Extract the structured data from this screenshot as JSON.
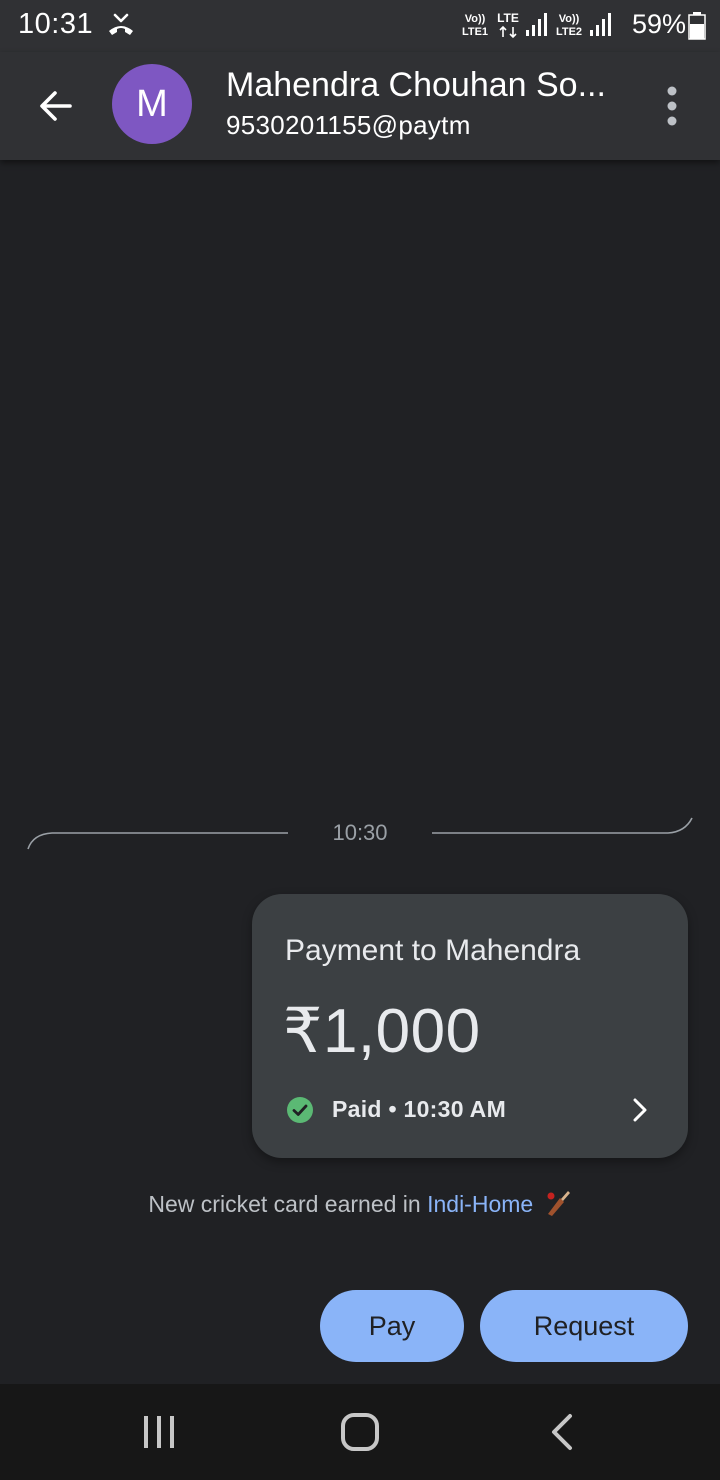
{
  "status_bar": {
    "time": "10:31",
    "battery": "59%",
    "sim1_label_top": "Vo))",
    "sim1_label_bottom": "LTE1",
    "data_label": "LTE",
    "sim2_label_top": "Vo))",
    "sim2_label_bottom": "LTE2",
    "icons": [
      "missed-call-icon",
      "signal-icon",
      "battery-icon"
    ]
  },
  "header": {
    "avatar_letter": "M",
    "avatar_color": "#7e57c2",
    "contact_name": "Mahendra Chouhan So...",
    "upi_id": "9530201155@paytm",
    "icons": [
      "back-arrow-icon",
      "more-vert-icon"
    ]
  },
  "conversation": {
    "timestamp": "10:30",
    "payment_card": {
      "title": "Payment to Mahendra",
      "amount": "₹1,000",
      "status": "Paid • 10:30 AM",
      "status_color": "#5bb974"
    },
    "reward_note": {
      "prefix": "New cricket card earned in ",
      "link": "Indi-Home"
    }
  },
  "actions": {
    "pay_label": "Pay",
    "request_label": "Request",
    "accent": "#8ab4f8"
  },
  "nav_bar": {
    "icons": [
      "recents-icon",
      "home-icon",
      "back-icon"
    ]
  }
}
